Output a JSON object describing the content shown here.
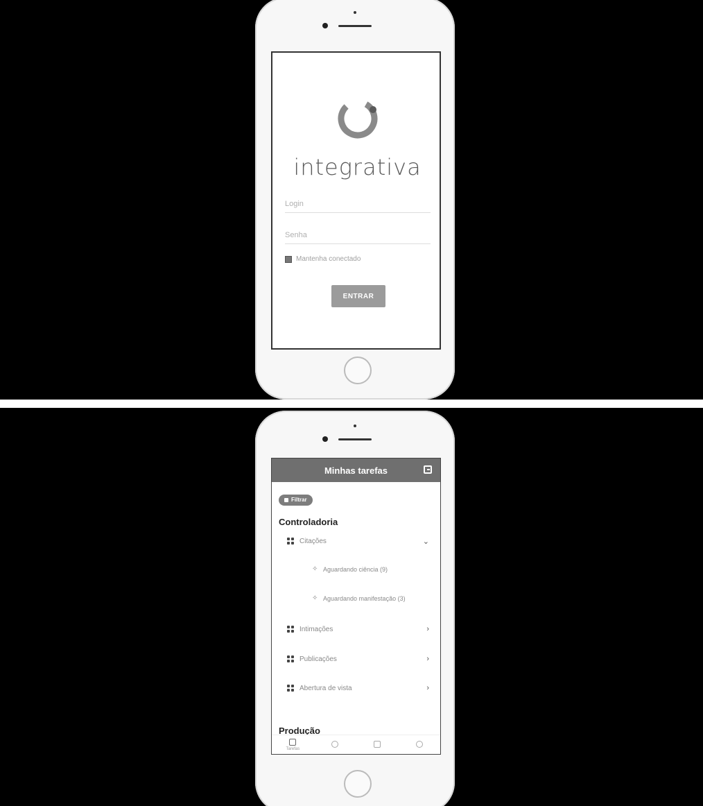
{
  "login": {
    "brand": "integrativa",
    "login_placeholder": "Login",
    "senha_placeholder": "Senha",
    "remember_label": "Mantenha conectado",
    "submit_label": "ENTRAR"
  },
  "tasks": {
    "header_title": "Minhas tarefas",
    "filter_label": "Filtrar",
    "sections": [
      {
        "title": "Controladoria",
        "items": [
          {
            "label": "Citações",
            "subitems": [
              "Aguardando ciência (9)",
              "Aguardando manifestação (3)"
            ]
          },
          {
            "label": "Intimações"
          },
          {
            "label": "Publicações"
          },
          {
            "label": "Abertura de vista"
          }
        ]
      },
      {
        "title": "Produção"
      }
    ],
    "nav": [
      "Tarefas",
      "",
      "",
      ""
    ]
  },
  "colors": {
    "background": "#000000",
    "appbar": "#6f6f6f",
    "button": "#9b9b9b"
  }
}
